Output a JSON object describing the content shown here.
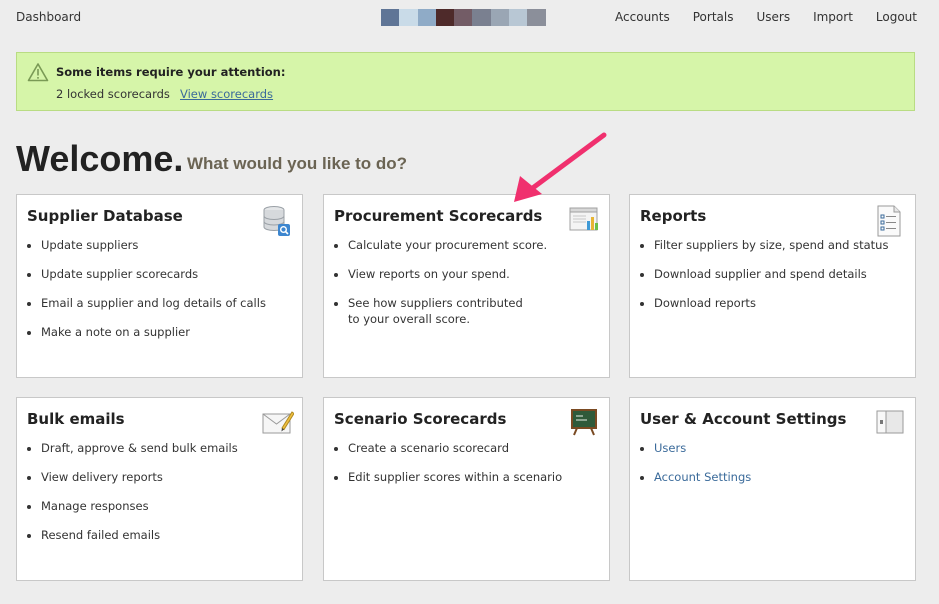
{
  "topbar": {
    "brand": "Dashboard",
    "swatch_colors": [
      "#5f7596",
      "#c9dbe8",
      "#8fabc7",
      "#4e2a2a",
      "#735c66",
      "#7a8090",
      "#9aa6b4",
      "#b8c7d4",
      "#8b8f9a"
    ],
    "nav": [
      "Accounts",
      "Portals",
      "Users",
      "Import",
      "Logout"
    ]
  },
  "alert": {
    "title": "Some items require your attention:",
    "count_text": "2 locked scorecards",
    "link_text": "View scorecards",
    "background": "#d6f5a9"
  },
  "welcome": {
    "heading": "Welcome.",
    "subheading": "What would you like to do?"
  },
  "cards": [
    {
      "title": "Supplier Database",
      "icon": "database-search-icon",
      "items": [
        "Update suppliers",
        "Update supplier scorecards",
        "Email a supplier and log details of calls",
        "Make a note on a supplier"
      ]
    },
    {
      "title": "Procurement Scorecards",
      "icon": "chart-window-icon",
      "items": [
        "Calculate your procurement score.",
        "View reports on your spend.",
        "See how suppliers contributed\nto your overall score."
      ]
    },
    {
      "title": "Reports",
      "icon": "checklist-document-icon",
      "items": [
        "Filter suppliers by size, spend and status",
        "Download supplier and spend details",
        "Download reports"
      ]
    },
    {
      "title": "Bulk emails",
      "icon": "envelope-pencil-icon",
      "items": [
        "Draft, approve & send bulk emails",
        "View delivery reports",
        "Manage responses",
        "Resend failed emails"
      ]
    },
    {
      "title": "Scenario Scorecards",
      "icon": "chalkboard-icon",
      "items": [
        "Create a scenario scorecard",
        "Edit supplier scores within a scenario"
      ]
    },
    {
      "title": "User & Account Settings",
      "icon": "settings-panel-icon",
      "items": [
        "Users",
        "Account Settings"
      ]
    }
  ],
  "annotation": {
    "arrow_color": "#f0306e",
    "arrow_icon": "pointer-arrow-annotation"
  }
}
